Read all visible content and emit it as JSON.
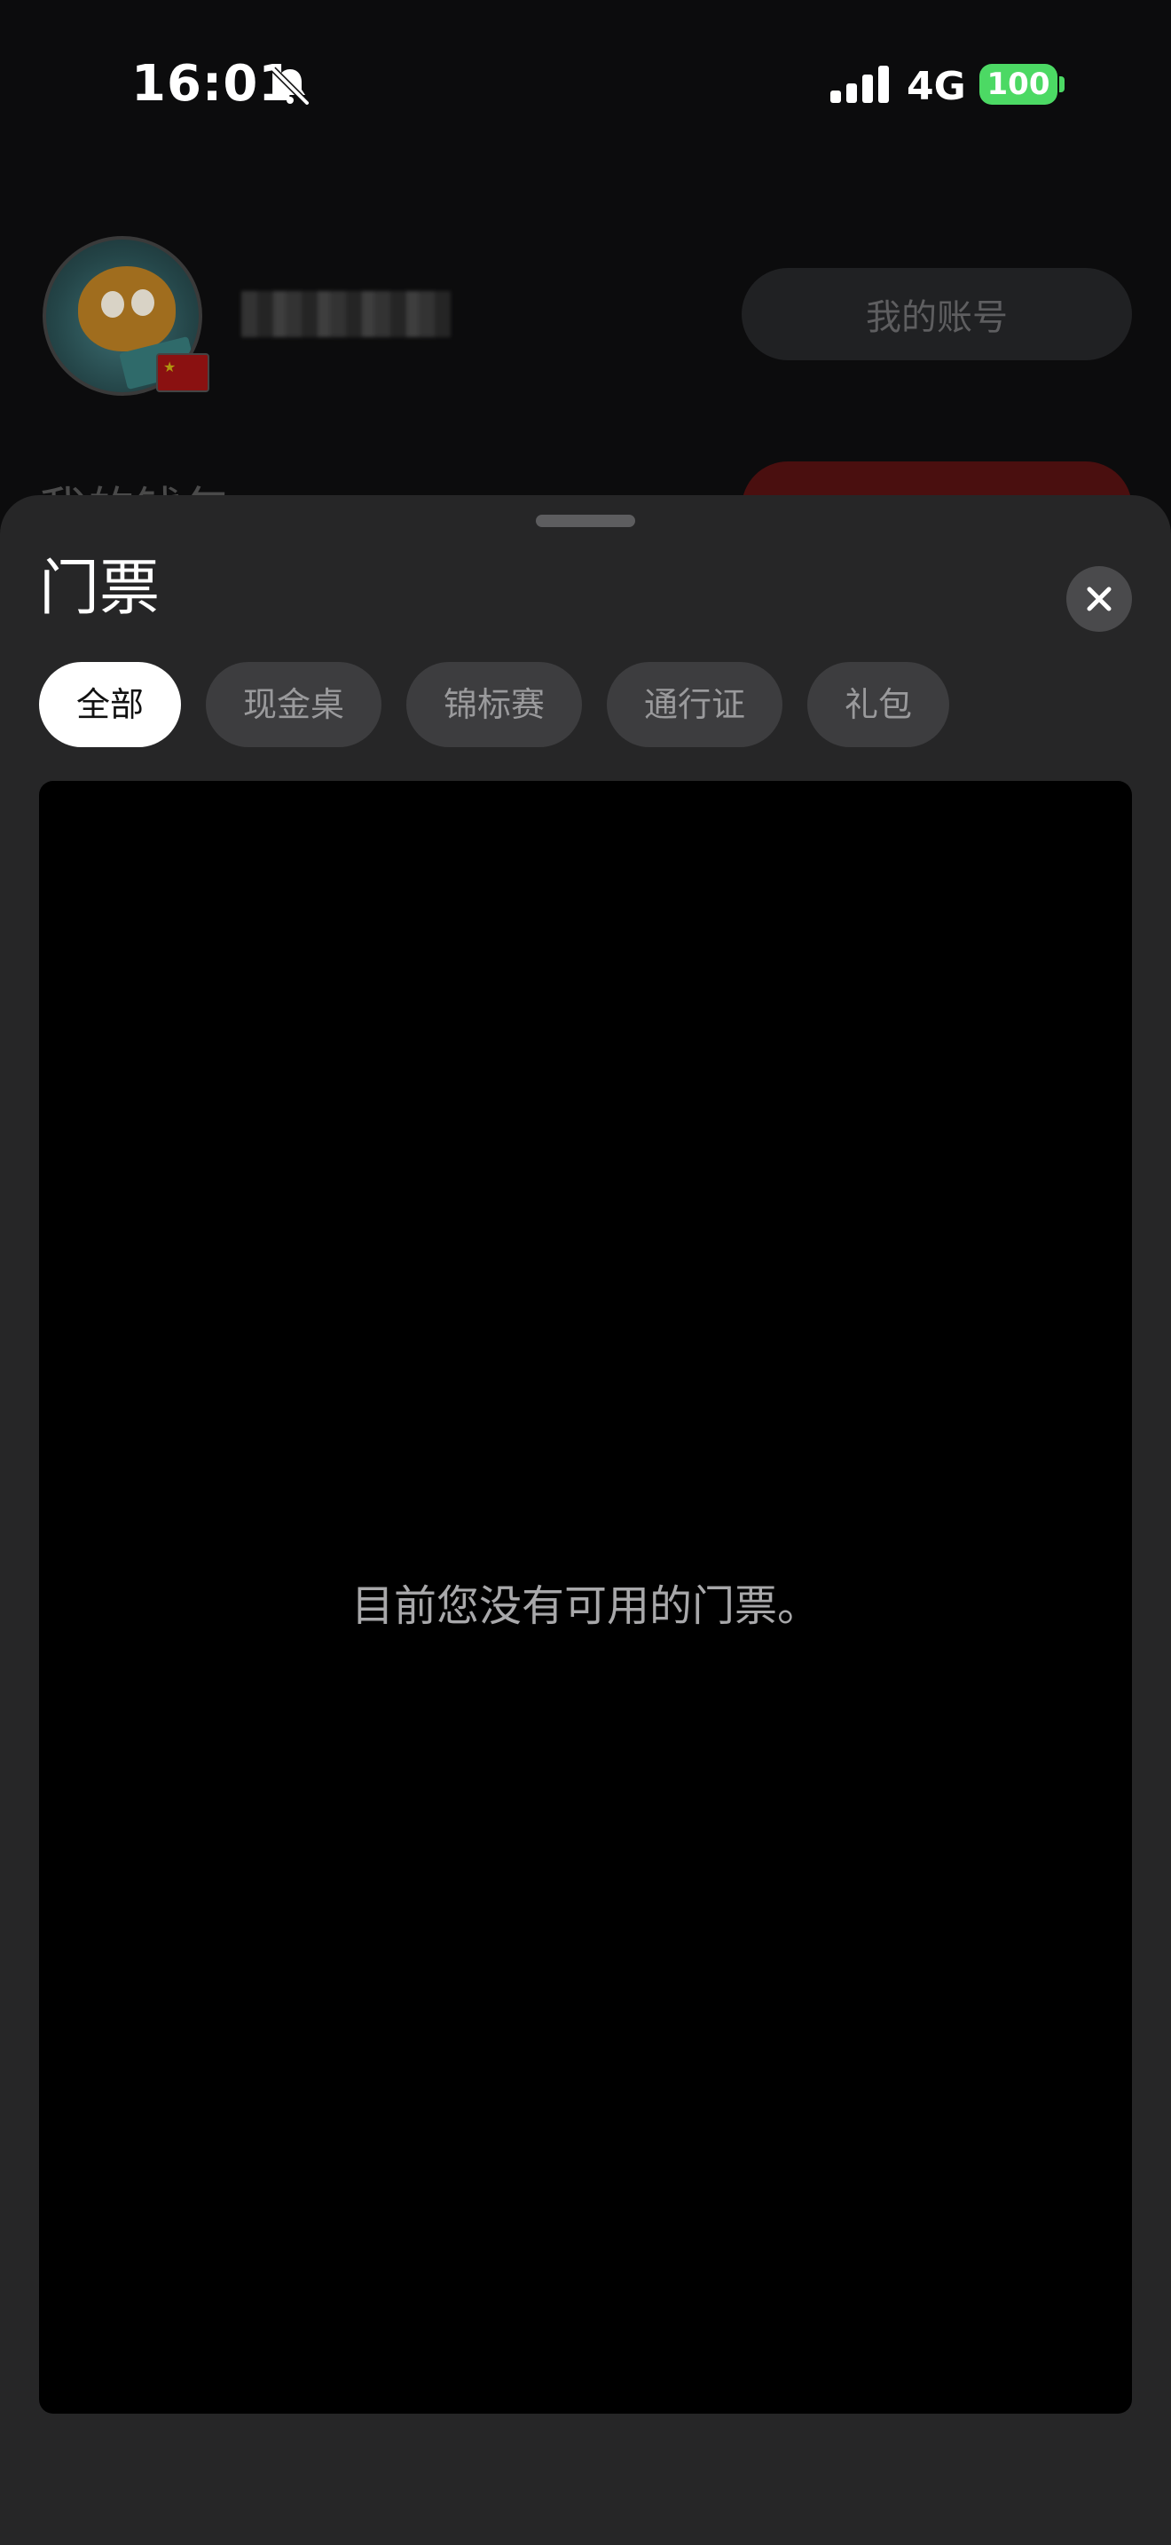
{
  "status_bar": {
    "time": "16:01",
    "network": "4G",
    "battery": "100",
    "colors": {
      "battery": "#4cd964"
    }
  },
  "profile": {
    "account_button": "我的账号",
    "wallet_title": "我的钱包"
  },
  "sheet": {
    "title": "门票",
    "tabs": [
      {
        "label": "全部",
        "active": true
      },
      {
        "label": "现金桌",
        "active": false
      },
      {
        "label": "锦标赛",
        "active": false
      },
      {
        "label": "通行证",
        "active": false
      },
      {
        "label": "礼包",
        "active": false
      }
    ],
    "empty_message": "目前您没有可用的门票。"
  },
  "icons": {
    "status": [
      "bell-slash-icon",
      "signal-icon",
      "battery-icon"
    ],
    "sheet": [
      "close-icon"
    ],
    "profile": [
      "avatar",
      "china-flag-icon"
    ]
  }
}
